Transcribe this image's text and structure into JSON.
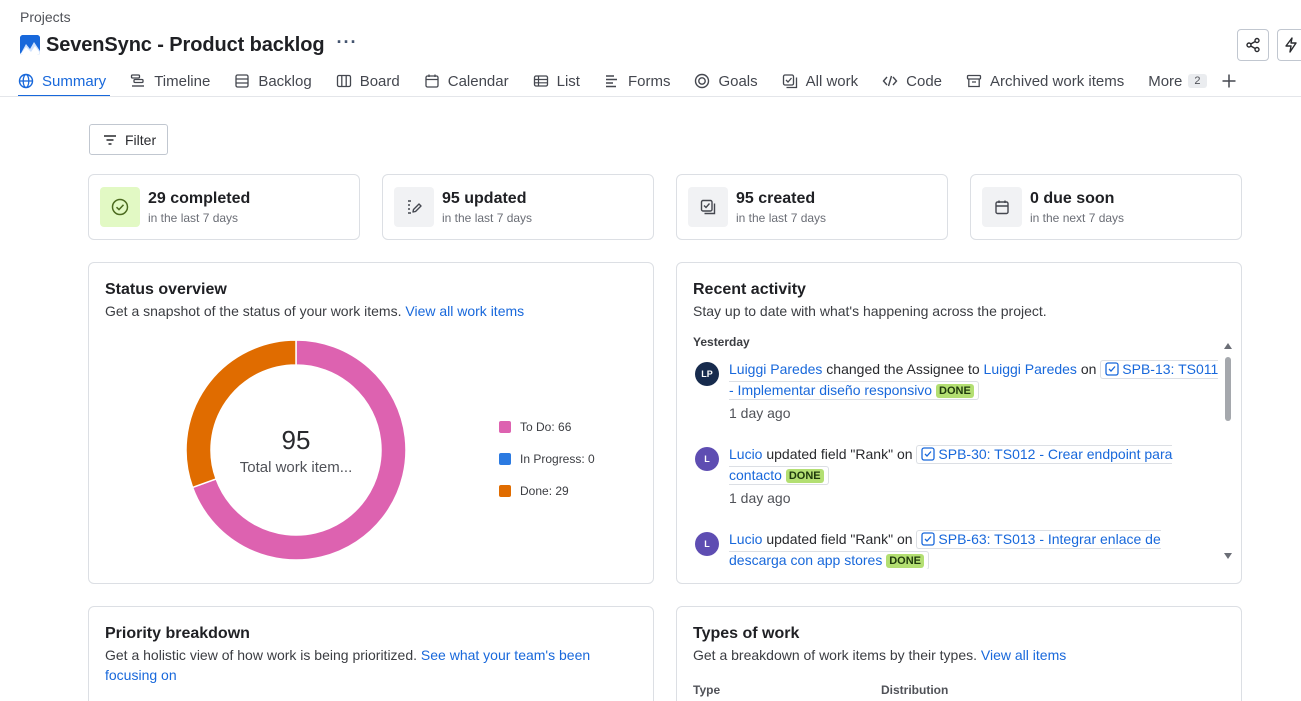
{
  "header": {
    "breadcrumb": "Projects",
    "title": "SevenSync - Product backlog",
    "more_label": "···"
  },
  "tabs": [
    {
      "label": "Summary",
      "icon": "globe-icon",
      "active": true
    },
    {
      "label": "Timeline",
      "icon": "timeline-icon"
    },
    {
      "label": "Backlog",
      "icon": "backlog-icon"
    },
    {
      "label": "Board",
      "icon": "board-icon"
    },
    {
      "label": "Calendar",
      "icon": "calendar-icon"
    },
    {
      "label": "List",
      "icon": "list-icon"
    },
    {
      "label": "Forms",
      "icon": "forms-icon"
    },
    {
      "label": "Goals",
      "icon": "goals-icon"
    },
    {
      "label": "All work",
      "icon": "all-work-icon"
    },
    {
      "label": "Code",
      "icon": "code-icon"
    },
    {
      "label": "Archived work items",
      "icon": "archive-icon"
    },
    {
      "label": "More",
      "count": "2"
    }
  ],
  "filter": {
    "label": "Filter"
  },
  "stats": [
    {
      "value": "29 completed",
      "sub": "in the last 7 days",
      "icon": "check-circle-icon"
    },
    {
      "value": "95 updated",
      "sub": "in the last 7 days",
      "icon": "edit-icon"
    },
    {
      "value": "95 created",
      "sub": "in the last 7 days",
      "icon": "created-icon"
    },
    {
      "value": "0 due soon",
      "sub": "in the next 7 days",
      "icon": "calendar-icon"
    }
  ],
  "status_overview": {
    "title": "Status overview",
    "desc": "Get a snapshot of the status of your work items.",
    "link": "View all work items",
    "total": "95",
    "total_label": "Total work item...",
    "legend": [
      {
        "label": "To Do: 66",
        "color": "#dd62b0"
      },
      {
        "label": "In Progress: 0",
        "color": "#2b7ae1"
      },
      {
        "label": "Done: 29",
        "color": "#e06c00"
      }
    ]
  },
  "chart_data": {
    "type": "pie",
    "categories": [
      "To Do",
      "In Progress",
      "Done"
    ],
    "values": [
      66,
      0,
      29
    ],
    "colors": [
      "#dd62b0",
      "#2b7ae1",
      "#e06c00"
    ],
    "title": "",
    "legend_position": "right"
  },
  "recent_activity": {
    "title": "Recent activity",
    "desc": "Stay up to date with what's happening across the project.",
    "day": "Yesterday",
    "items": [
      {
        "avatar": "LP",
        "avatar_color": "#172b4d",
        "user": "Luiggi Paredes",
        "action": " changed the Assignee to ",
        "target_user": "Luiggi Paredes",
        "on": " on ",
        "issue": "SPB-13: TS011 - Implementar diseño responsivo",
        "status": "DONE",
        "time": "1 day ago"
      },
      {
        "avatar": "L",
        "avatar_color": "#5e4db2",
        "user": "Lucio",
        "action": " updated field \"Rank\" on ",
        "issue": "SPB-30: TS012 - Crear endpoint para contacto",
        "status": "DONE",
        "time": "1 day ago"
      },
      {
        "avatar": "L",
        "avatar_color": "#5e4db2",
        "user": "Lucio",
        "action": " updated field \"Rank\" on ",
        "issue": "SPB-63: TS013 - Integrar enlace de descarga con app stores",
        "status": "DONE",
        "time": ""
      }
    ]
  },
  "priority": {
    "title": "Priority breakdown",
    "desc": "Get a holistic view of how work is being prioritized.",
    "link": "See what your team's been focusing on"
  },
  "types": {
    "title": "Types of work",
    "desc": "Get a breakdown of work items by their types.",
    "link": "View all items",
    "col_type": "Type",
    "col_distribution": "Distribution"
  }
}
